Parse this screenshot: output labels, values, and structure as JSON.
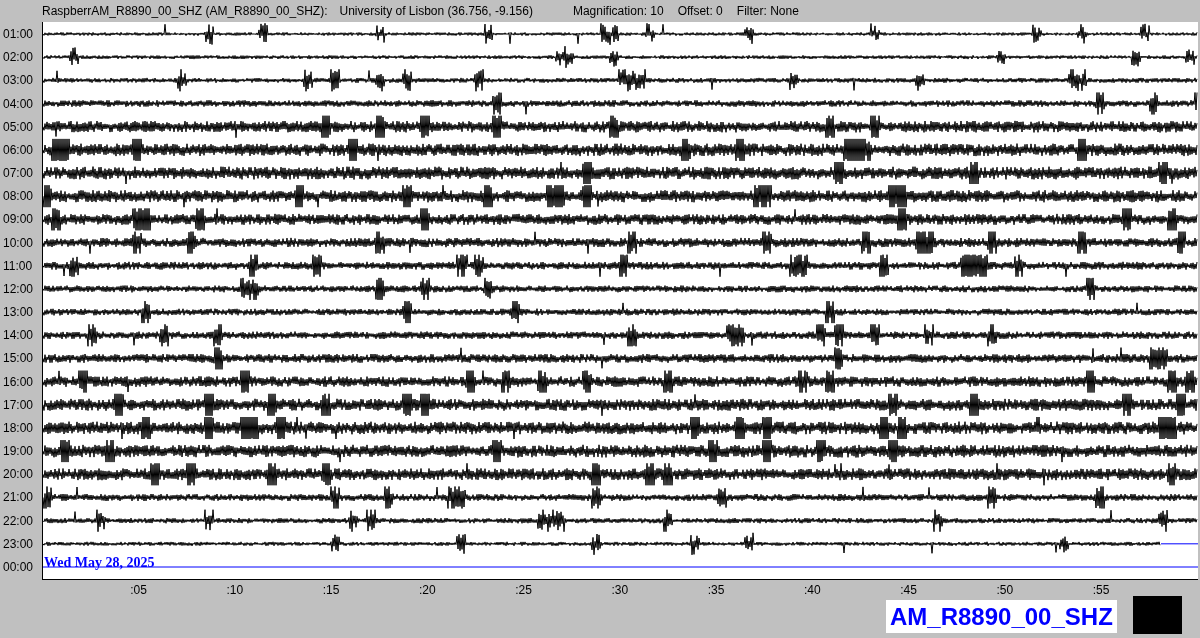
{
  "header": {
    "station": "RaspberrAM_R8890_00_SHZ (AM_R8890_00_SHZ):",
    "location": "University of Lisbon (36.756, -9.156)",
    "magnification": "Magnification: 10",
    "offset": "Offset: 0",
    "filter": "Filter: None"
  },
  "rows": [
    {
      "label": "01:00",
      "kind": "full"
    },
    {
      "label": "02:00",
      "kind": "full"
    },
    {
      "label": "03:00",
      "kind": "full"
    },
    {
      "label": "04:00",
      "kind": "full"
    },
    {
      "label": "05:00",
      "kind": "full"
    },
    {
      "label": "06:00",
      "kind": "full"
    },
    {
      "label": "07:00",
      "kind": "full"
    },
    {
      "label": "08:00",
      "kind": "full"
    },
    {
      "label": "09:00",
      "kind": "full"
    },
    {
      "label": "10:00",
      "kind": "full"
    },
    {
      "label": "11:00",
      "kind": "full"
    },
    {
      "label": "12:00",
      "kind": "full"
    },
    {
      "label": "13:00",
      "kind": "full"
    },
    {
      "label": "14:00",
      "kind": "full"
    },
    {
      "label": "15:00",
      "kind": "full"
    },
    {
      "label": "16:00",
      "kind": "full"
    },
    {
      "label": "17:00",
      "kind": "full"
    },
    {
      "label": "18:00",
      "kind": "full"
    },
    {
      "label": "19:00",
      "kind": "full"
    },
    {
      "label": "20:00",
      "kind": "full"
    },
    {
      "label": "21:00",
      "kind": "full"
    },
    {
      "label": "22:00",
      "kind": "full"
    },
    {
      "label": "23:00",
      "kind": "partial"
    },
    {
      "label": "00:00",
      "kind": "empty"
    }
  ],
  "date": "Wed May 28, 2025",
  "x_ticks": [
    ":05",
    ":10",
    ":15",
    ":20",
    ":25",
    ":30",
    ":35",
    ":40",
    ":45",
    ":50",
    ":55"
  ],
  "station_label": "AM_R8890_00_SHZ"
}
